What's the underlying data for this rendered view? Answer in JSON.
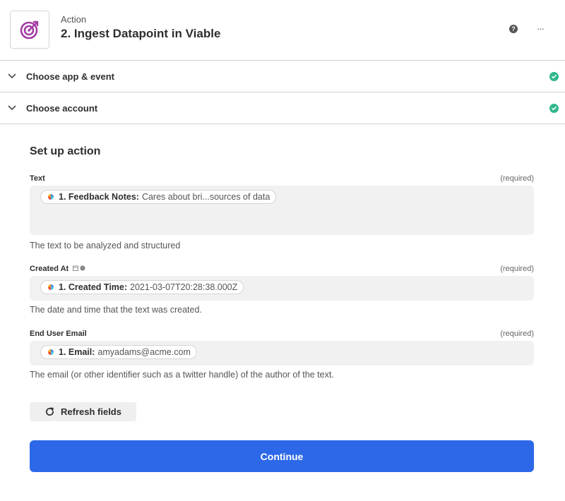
{
  "header": {
    "step_label": "Action",
    "step_title": "2. Ingest Datapoint in Viable",
    "app_icon": "target-icon",
    "help_icon": "question-icon",
    "more_icon": "more-icon"
  },
  "sections": [
    {
      "label": "Choose app & event",
      "status": "complete"
    },
    {
      "label": "Choose account",
      "status": "complete"
    }
  ],
  "setup": {
    "title": "Set up action",
    "fields": [
      {
        "label": "Text",
        "required": "(required)",
        "pill_key": "1. Feedback Notes:",
        "pill_value": "Cares about bri...sources of data",
        "help": "The text to be analyzed and structured"
      },
      {
        "label": "Created At",
        "required": "(required)",
        "pill_key": "1. Created Time:",
        "pill_value": "2021-03-07T20:28:38.000Z",
        "help": "The date and time that the text was created."
      },
      {
        "label": "End User Email",
        "required": "(required)",
        "pill_key": "1. Email:",
        "pill_value": "amyadams@acme.com",
        "help": "The email (or other identifier such as a twitter handle) of the author of the text."
      }
    ],
    "refresh_label": "Refresh fields",
    "continue_label": "Continue"
  },
  "colors": {
    "accent": "#2c68e8",
    "success": "#2fb78d",
    "app_icon": "#a33ca4"
  }
}
